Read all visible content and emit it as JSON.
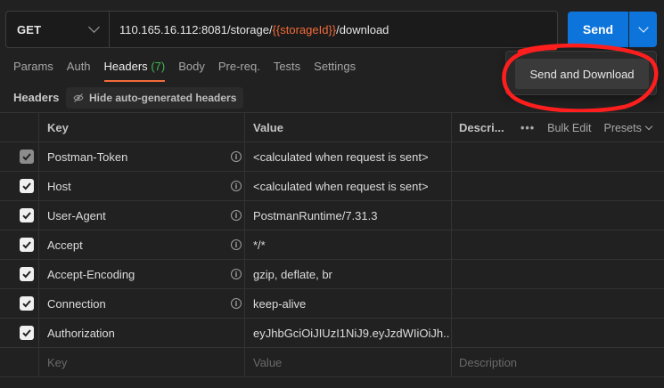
{
  "request": {
    "method": "GET",
    "url_prefix": "110.165.16.112:8081/storage/",
    "url_variable": "{{storageId}}",
    "url_suffix": "/download"
  },
  "send": {
    "label": "Send"
  },
  "dropdown": {
    "send_and_download": "Send and Download"
  },
  "tabs": [
    {
      "label": "Params"
    },
    {
      "label": "Auth"
    },
    {
      "label": "Headers",
      "count": "(7)",
      "active": true
    },
    {
      "label": "Body"
    },
    {
      "label": "Pre-req."
    },
    {
      "label": "Tests"
    },
    {
      "label": "Settings"
    }
  ],
  "headers_section": {
    "title": "Headers",
    "hide_button": "Hide auto-generated headers"
  },
  "table": {
    "columns": {
      "key": "Key",
      "value": "Value",
      "description": "Descri..."
    },
    "tools": {
      "more": "•••",
      "bulk_edit": "Bulk Edit",
      "presets": "Presets"
    },
    "rows": [
      {
        "key": "Postman-Token",
        "value": "<calculated when request is sent>",
        "checked": true,
        "disabled": true
      },
      {
        "key": "Host",
        "value": "<calculated when request is sent>",
        "checked": true
      },
      {
        "key": "User-Agent",
        "value": "PostmanRuntime/7.31.3",
        "checked": true
      },
      {
        "key": "Accept",
        "value": "*/*",
        "checked": true
      },
      {
        "key": "Accept-Encoding",
        "value": "gzip, deflate, br",
        "checked": true
      },
      {
        "key": "Connection",
        "value": "keep-alive",
        "checked": true
      },
      {
        "key": "Authorization",
        "value": "eyJhbGciOiJIUzI1NiJ9.eyJzdWIiOiJh...",
        "checked": true
      }
    ],
    "placeholders": {
      "key": "Key",
      "value": "Value",
      "description": "Description"
    }
  },
  "colors": {
    "accent": "#f26b3a",
    "send_blue": "#0d74dc",
    "count_green": "#3fb950",
    "annotation_red": "#ff1e1e"
  }
}
